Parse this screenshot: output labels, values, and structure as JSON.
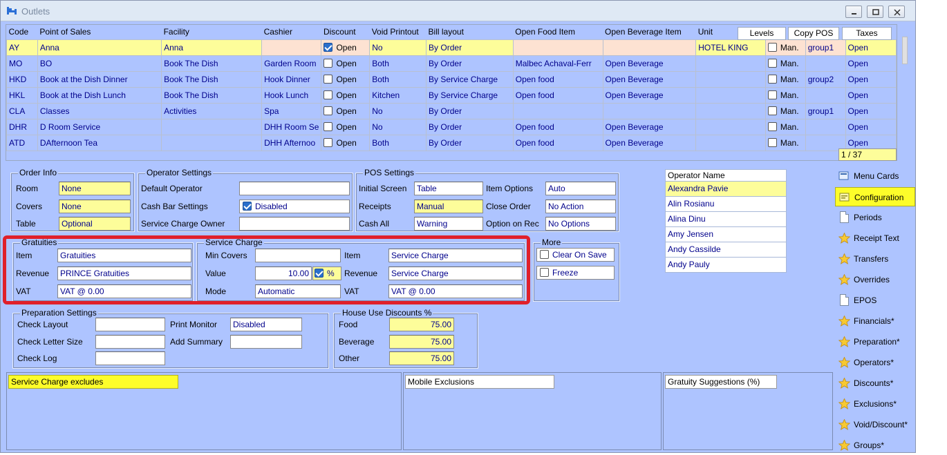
{
  "window": {
    "title": "Outlets"
  },
  "grid": {
    "headers": [
      "Code",
      "Point of Sales",
      "Facility",
      "Cashier",
      "Discount",
      "Void Printout",
      "Bill layout",
      "Open Food Item",
      "Open Beverage Item",
      "Unit"
    ],
    "header_buttons": {
      "levels": "Levels",
      "copy_pos": "Copy POS",
      "taxes": "Taxes"
    },
    "rows": [
      {
        "code": "AY",
        "pos": "Anna",
        "facility": "Anna",
        "cashier": "",
        "discount_checked": true,
        "discount": "Open",
        "void": "No",
        "bill": "By Order",
        "food": "",
        "bev": "",
        "unit": "HOTEL KING",
        "man_checked": false,
        "man": "Man.",
        "level": "group1",
        "tax": "Open"
      },
      {
        "code": "MO",
        "pos": "BO",
        "facility": "Book The Dish",
        "cashier": "Garden Room",
        "discount_checked": false,
        "discount": "Open",
        "void": "Both",
        "bill": "By Order",
        "food": "Malbec Achaval-Ferr",
        "bev": "Open Beverage",
        "unit": "",
        "man_checked": false,
        "man": "Man.",
        "level": "",
        "tax": "Open"
      },
      {
        "code": "HKD",
        "pos": "Book at the Dish Dinner",
        "facility": "Book The Dish",
        "cashier": "Hook Dinner",
        "discount_checked": false,
        "discount": "Open",
        "void": "Both",
        "bill": "By Service Charge",
        "food": "Open food",
        "bev": "Open Beverage",
        "unit": "",
        "man_checked": false,
        "man": "Man.",
        "level": "group2",
        "tax": "Open"
      },
      {
        "code": "HKL",
        "pos": "Book at the Dish Lunch",
        "facility": "Book The Dish",
        "cashier": "Hook Lunch",
        "discount_checked": false,
        "discount": "Open",
        "void": "Kitchen",
        "bill": "By Service Charge",
        "food": "Open food",
        "bev": "Open Beverage",
        "unit": "",
        "man_checked": false,
        "man": "Man.",
        "level": "",
        "tax": "Open"
      },
      {
        "code": "CLA",
        "pos": "Classes",
        "facility": "Activities",
        "cashier": "Spa",
        "discount_checked": false,
        "discount": "Open",
        "void": "No",
        "bill": "By Order",
        "food": "",
        "bev": "",
        "unit": "",
        "man_checked": false,
        "man": "Man.",
        "level": "group1",
        "tax": "Open"
      },
      {
        "code": "DHR",
        "pos": "D Room Service",
        "facility": "",
        "cashier": "DHH Room Se",
        "discount_checked": false,
        "discount": "Open",
        "void": "No",
        "bill": "By Order",
        "food": "Open food",
        "bev": "Open Beverage",
        "unit": "",
        "man_checked": false,
        "man": "Man.",
        "level": "",
        "tax": "Open"
      },
      {
        "code": "ATD",
        "pos": "DAfternoon Tea",
        "facility": "",
        "cashier": "DHH Afternoo",
        "discount_checked": false,
        "discount": "Open",
        "void": "Both",
        "bill": "By Order",
        "food": "Open food",
        "bev": "Open Beverage",
        "unit": "",
        "man_checked": false,
        "man": "Man.",
        "level": "",
        "tax": "Open"
      }
    ],
    "counter": "1 / 37"
  },
  "order_info": {
    "title": "Order Info",
    "room_label": "Room",
    "room": "None",
    "covers_label": "Covers",
    "covers": "None",
    "table_label": "Table",
    "table": "Optional"
  },
  "operator_settings": {
    "title": "Operator Settings",
    "default_label": "Default Operator",
    "default": "",
    "cashbar_label": "Cash Bar Settings",
    "cashbar": "Disabled",
    "sco_label": "Service Charge Owner",
    "sco": ""
  },
  "pos_settings": {
    "title": "POS Settings",
    "initial_label": "Initial Screen",
    "initial": "Table",
    "receipts_label": "Receipts",
    "receipts": "Manual",
    "cashall_label": "Cash All",
    "cashall": "Warning",
    "itemopt_label": "Item Options",
    "itemopt": "Auto",
    "close_label": "Close Order",
    "close": "No Action",
    "optrec_label": "Option on Rec",
    "optrec": "No Options"
  },
  "gratuities": {
    "title": "Gratuities",
    "item_label": "Item",
    "item": "Gratuities",
    "revenue_label": "Revenue",
    "revenue": "PRINCE Gratuities",
    "vat_label": "VAT",
    "vat": "VAT @ 0.00"
  },
  "service_charge": {
    "title": "Service Charge",
    "mincovers_label": "Min Covers",
    "mincovers": "",
    "value_label": "Value",
    "value": "10.00",
    "pct": "%",
    "mode_label": "Mode",
    "mode": "Automatic",
    "item_label": "Item",
    "item": "Service Charge",
    "revenue_label": "Revenue",
    "revenue": "Service Charge",
    "vat_label": "VAT",
    "vat": "VAT @ 0.00"
  },
  "more": {
    "title": "More",
    "clear": "Clear On Save",
    "freeze": "Freeze"
  },
  "prep": {
    "title": "Preparation Settings",
    "layout_label": "Check Layout",
    "layout": "",
    "size_label": "Check Letter Size",
    "size": "",
    "log_label": "Check Log",
    "log": "",
    "monitor_label": "Print Monitor",
    "monitor": "Disabled",
    "summary_label": "Add Summary",
    "summary": ""
  },
  "house": {
    "title": "House Use Discounts %",
    "food_label": "Food",
    "food": "75.00",
    "bev_label": "Beverage",
    "bev": "75.00",
    "other_label": "Other",
    "other": "75.00"
  },
  "operators": {
    "header": "Operator Name",
    "names": [
      "Alexandra Pavie",
      "Alin Rosianu",
      "Alina Dinu",
      "Amy Jensen",
      "Andy Cassilde",
      "Andy Pauly"
    ]
  },
  "side": [
    {
      "label": "Menu Cards",
      "icon": "menu-cards-icon"
    },
    {
      "label": "Configuration",
      "icon": "configuration-icon"
    },
    {
      "label": "Periods",
      "icon": "document-icon"
    },
    {
      "label": "Receipt Text",
      "icon": "star-icon"
    },
    {
      "label": "Transfers",
      "icon": "star-icon"
    },
    {
      "label": "Overrides",
      "icon": "star-icon"
    },
    {
      "label": "EPOS",
      "icon": "document-icon"
    },
    {
      "label": "Financials*",
      "icon": "star-icon"
    },
    {
      "label": "Preparation*",
      "icon": "star-icon"
    },
    {
      "label": "Operators*",
      "icon": "star-icon"
    },
    {
      "label": "Discounts*",
      "icon": "star-icon"
    },
    {
      "label": "Exclusions*",
      "icon": "star-icon"
    },
    {
      "label": "Void/Discount*",
      "icon": "star-icon"
    },
    {
      "label": "Groups*",
      "icon": "star-icon"
    }
  ],
  "bottom": {
    "sce": "Service Charge excludes",
    "mobile": "Mobile Exclusions",
    "gratuity": "Gratuity Suggestions (%)"
  },
  "colors": {
    "background": "#aec4ff",
    "highlight": "#fdfd9a",
    "selected_row": "#fde2d2",
    "active_side": "#fdfd2a",
    "red_frame": "#e0202a"
  }
}
